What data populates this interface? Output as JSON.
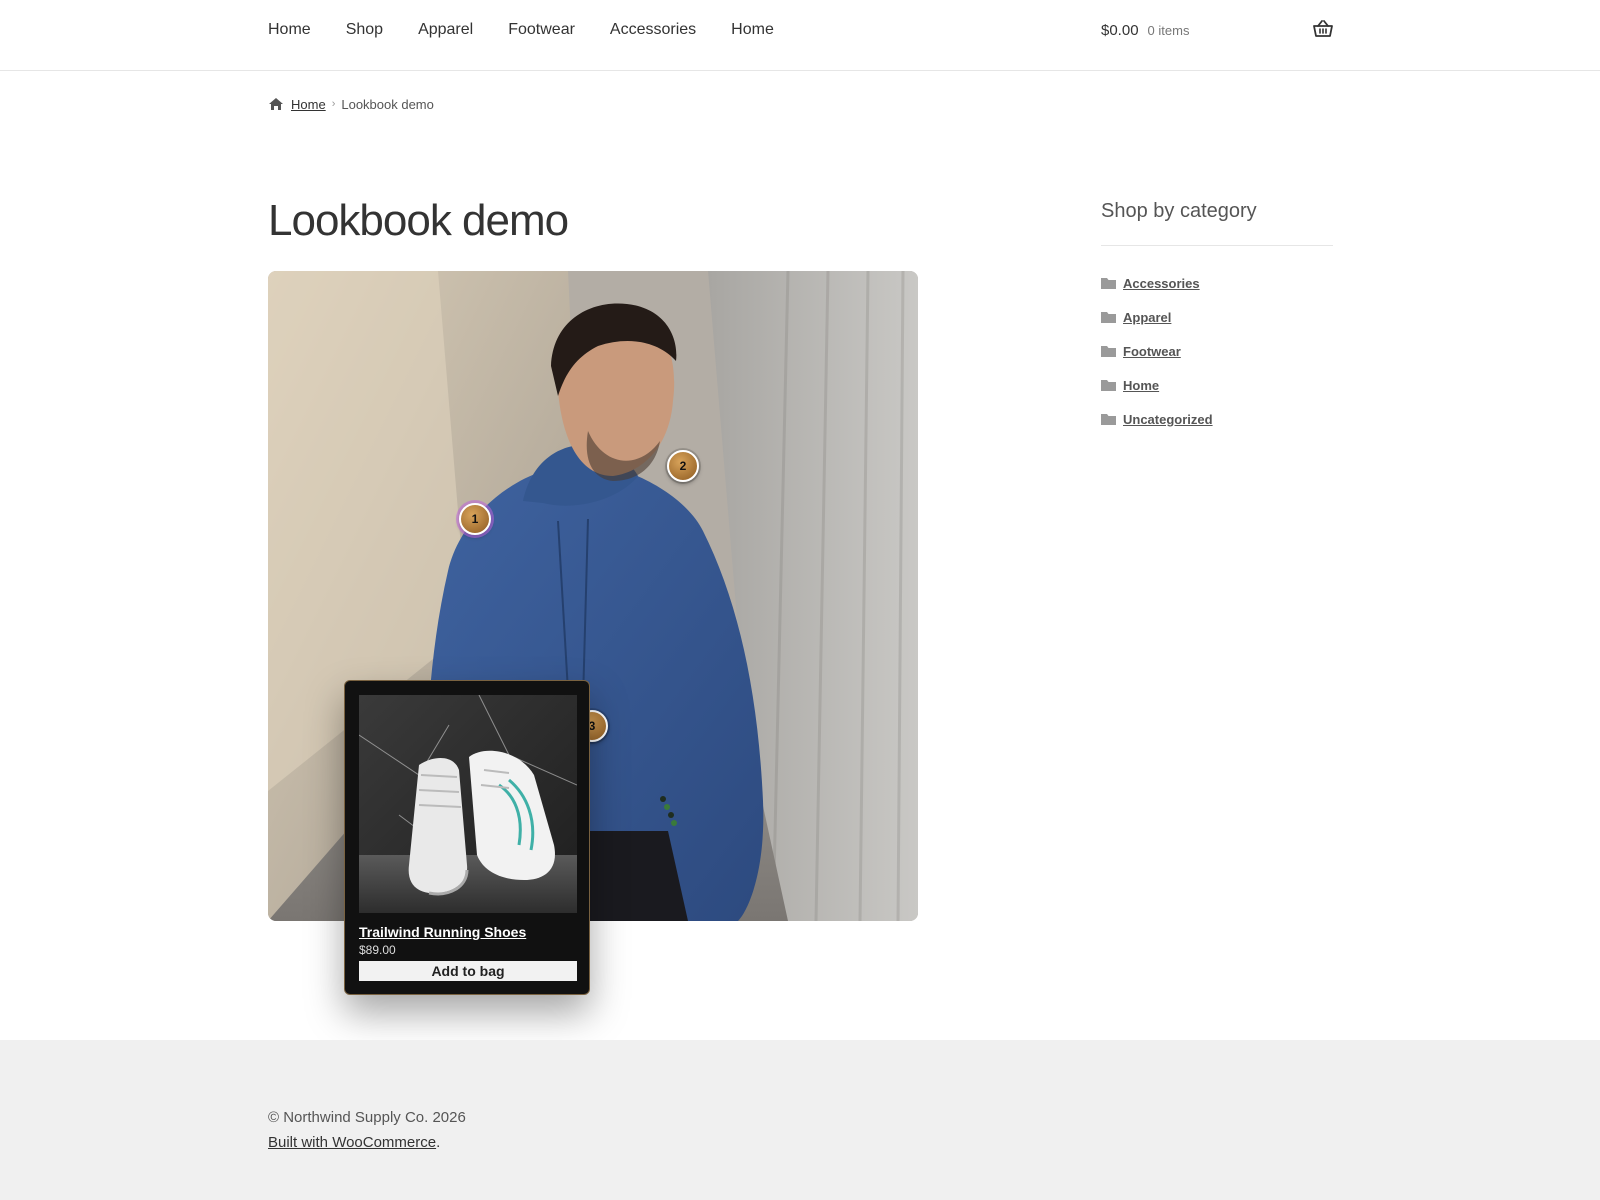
{
  "nav": {
    "items": [
      "Home",
      "Shop",
      "Apparel",
      "Footwear",
      "Accessories",
      "Home"
    ]
  },
  "cart": {
    "amount": "$0.00",
    "count": "0 items",
    "icon": "basket-icon"
  },
  "breadcrumb": {
    "home": "Home",
    "separator": "›",
    "current": "Lookbook demo"
  },
  "page": {
    "title": "Lookbook demo"
  },
  "lookbook": {
    "hotspots": [
      "1",
      "2",
      "3"
    ],
    "popup": {
      "product_name": "Trailwind Running Shoes",
      "price": "$89.00",
      "button_label": "Add to bag"
    }
  },
  "sidebar": {
    "title": "Shop by category",
    "categories": [
      "Accessories",
      "Apparel",
      "Footwear",
      "Home",
      "Uncategorized"
    ]
  },
  "footer": {
    "copyright": "© Northwind Supply Co. 2026",
    "built_link": "Built with WooCommerce",
    "built_suffix": "."
  },
  "colors": {
    "hotspot": "#b27c3a",
    "hoodie": "#36578f",
    "popup_bg": "#111111",
    "footer_bg": "#f0f0f0"
  }
}
